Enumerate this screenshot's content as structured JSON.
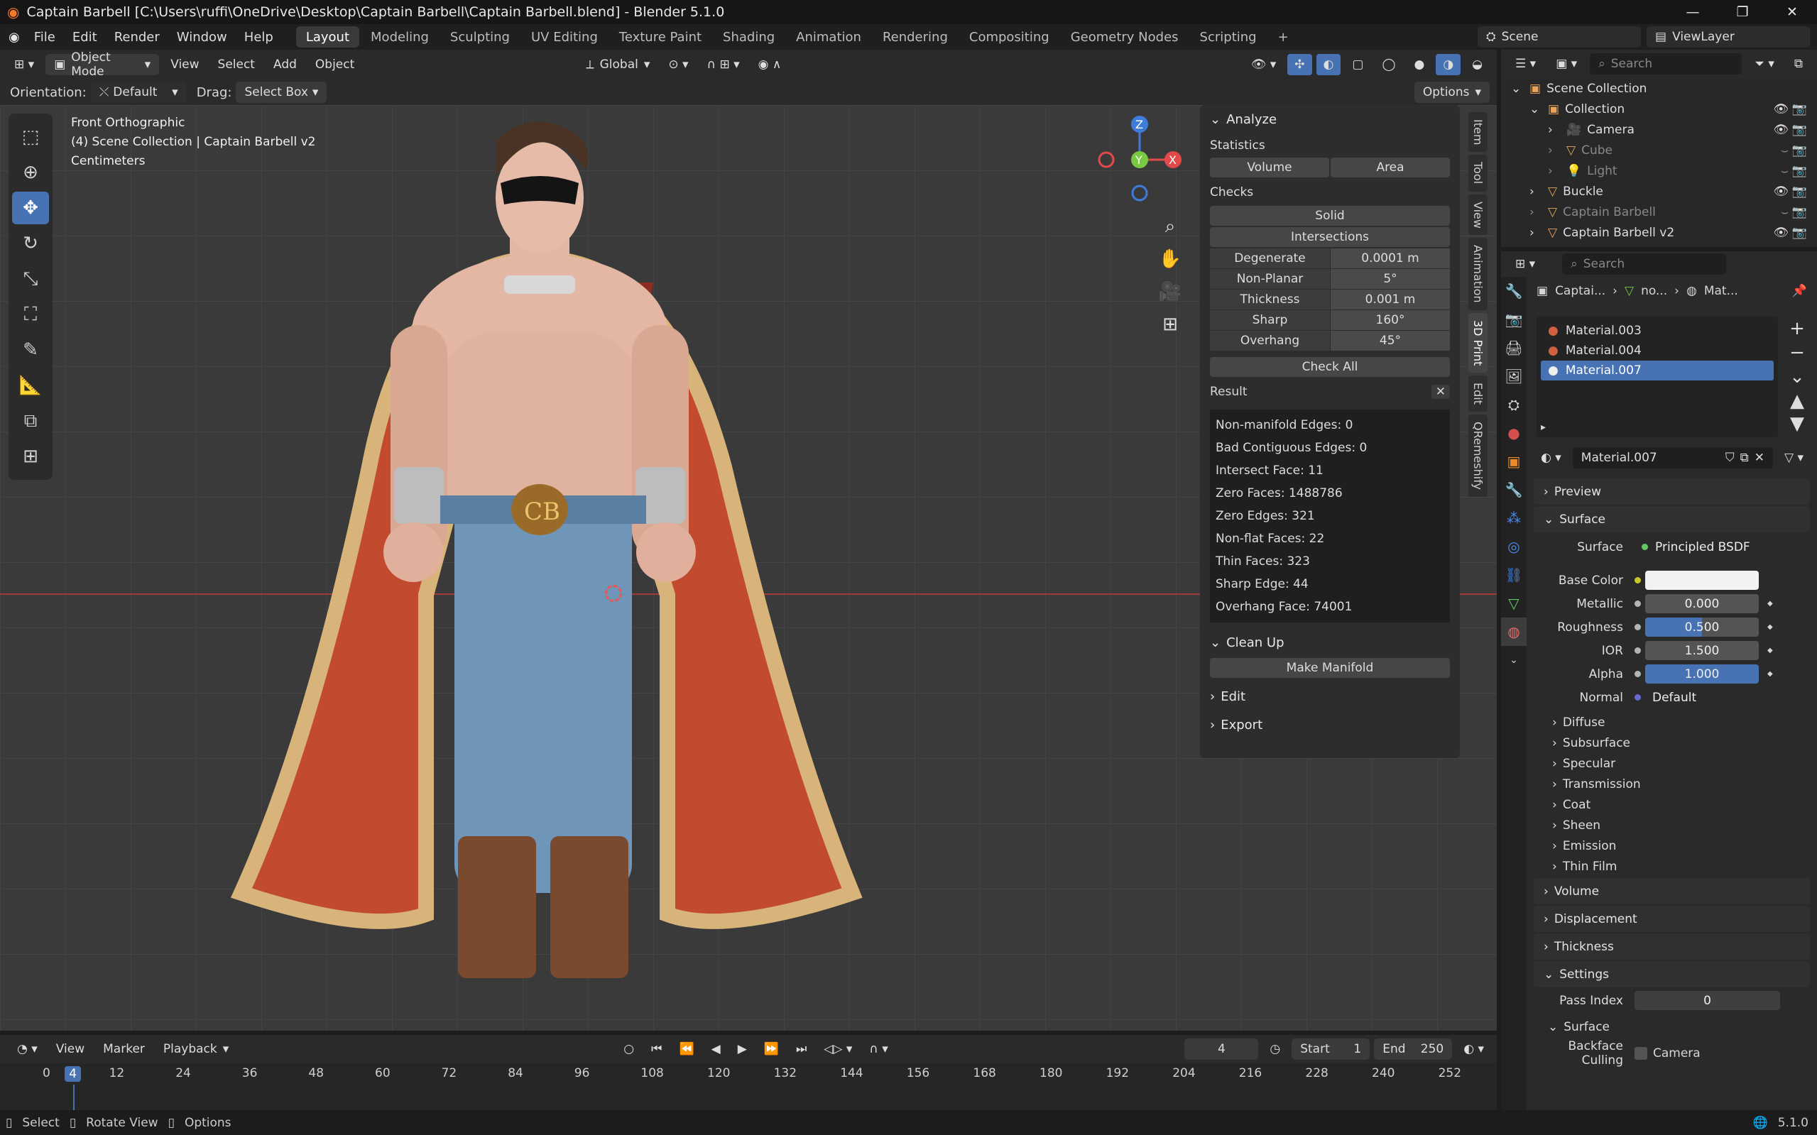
{
  "window": {
    "title": "Captain Barbell [C:\\Users\\ruffi\\OneDrive\\Desktop\\Captain Barbell\\Captain Barbell.blend] - Blender 5.1.0"
  },
  "menu": {
    "items": [
      "File",
      "Edit",
      "Render",
      "Window",
      "Help"
    ]
  },
  "workspaces": [
    "Layout",
    "Modeling",
    "Sculpting",
    "UV Editing",
    "Texture Paint",
    "Shading",
    "Animation",
    "Rendering",
    "Compositing",
    "Geometry Nodes",
    "Scripting"
  ],
  "workspace_active": "Layout",
  "scene": {
    "label": "Scene",
    "view_layer": "ViewLayer"
  },
  "viewport_header": {
    "mode": "Object Mode",
    "menus": [
      "View",
      "Select",
      "Add",
      "Object"
    ],
    "transform": "Global"
  },
  "viewport_tool": {
    "orientation_label": "Orientation:",
    "orientation_value": "Default",
    "drag_label": "Drag:",
    "drag_value": "Select Box",
    "options": "Options"
  },
  "viewport_info": {
    "view": "Front Orthographic",
    "collection": "(4) Scene Collection | Captain Barbell v2",
    "units": "Centimeters"
  },
  "gizmo": {
    "x": "X",
    "y": "Y",
    "z": "Z"
  },
  "npanel": {
    "analyze_title": "Analyze",
    "statistics_label": "Statistics",
    "volume": "Volume",
    "area": "Area",
    "checks_label": "Checks",
    "solid": "Solid",
    "intersections": "Intersections",
    "checks": [
      {
        "k": "Degenerate",
        "v": "0.0001 m"
      },
      {
        "k": "Non-Planar",
        "v": "5°"
      },
      {
        "k": "Thickness",
        "v": "0.001 m"
      },
      {
        "k": "Sharp",
        "v": "160°"
      },
      {
        "k": "Overhang",
        "v": "45°"
      }
    ],
    "check_all": "Check All",
    "result_label": "Result",
    "results": [
      "Non-manifold Edges: 0",
      "Bad Contiguous Edges: 0",
      "Intersect Face: 11",
      "Zero Faces: 1488786",
      "Zero Edges: 321",
      "Non-flat Faces: 22",
      "Thin Faces: 323",
      "Sharp Edge: 44",
      "Overhang Face: 74001"
    ],
    "cleanup_title": "Clean Up",
    "make_manifold": "Make Manifold",
    "edit": "Edit",
    "export": "Export"
  },
  "vtabs": [
    "Item",
    "Tool",
    "View",
    "Animation",
    "3D Print",
    "Edit",
    "QRemeshify"
  ],
  "timeline": {
    "menus": [
      "Marker",
      "Playback"
    ],
    "view": "View",
    "current_frame": "4",
    "start_label": "Start",
    "start": "1",
    "end_label": "End",
    "end": "250",
    "ticks": [
      "0",
      "4",
      "12",
      "24",
      "36",
      "48",
      "60",
      "72",
      "84",
      "96",
      "108",
      "120",
      "132",
      "144",
      "156",
      "168",
      "180",
      "192",
      "204",
      "216",
      "228",
      "240",
      "252"
    ]
  },
  "outliner": {
    "search_placeholder": "Search",
    "rows": [
      {
        "label": "Scene Collection",
        "indent": 0
      },
      {
        "label": "Collection",
        "indent": 1
      },
      {
        "label": "Camera",
        "indent": 2
      },
      {
        "label": "Cube",
        "indent": 2
      },
      {
        "label": "Light",
        "indent": 2
      },
      {
        "label": "Buckle",
        "indent": 1
      },
      {
        "label": "Captain Barbell",
        "indent": 1
      },
      {
        "label": "Captain Barbell v2",
        "indent": 1
      }
    ]
  },
  "properties": {
    "search_placeholder": "Search",
    "breadcrumb": [
      "Captai...",
      "no...",
      "Mat..."
    ],
    "materials": [
      "Material.003",
      "Material.004",
      "Material.007"
    ],
    "selected_material": "Material.007",
    "preview": "Preview",
    "surface_section": "Surface",
    "surface_label": "Surface",
    "surface_value": "Principled BSDF",
    "base_color_label": "Base Color",
    "fields": [
      {
        "k": "Metallic",
        "v": "0.000",
        "fill": 0.0
      },
      {
        "k": "Roughness",
        "v": "0.500",
        "fill": 0.5
      },
      {
        "k": "IOR",
        "v": "1.500",
        "fill": 0.0
      },
      {
        "k": "Alpha",
        "v": "1.000",
        "fill": 1.0
      }
    ],
    "normal_label": "Normal",
    "normal_value": "Default",
    "subsections": [
      "Diffuse",
      "Subsurface",
      "Specular",
      "Transmission",
      "Coat",
      "Sheen",
      "Emission",
      "Thin Film"
    ],
    "volume": "Volume",
    "displacement": "Displacement",
    "thickness": "Thickness",
    "settings": "Settings",
    "pass_index_label": "Pass Index",
    "pass_index": "0",
    "settings_surface": "Surface",
    "backface_label": "Backface Culling",
    "backface_value": "Camera"
  },
  "status": {
    "select": "Select",
    "rotate": "Rotate View",
    "options": "Options",
    "version": "5.1.0"
  }
}
